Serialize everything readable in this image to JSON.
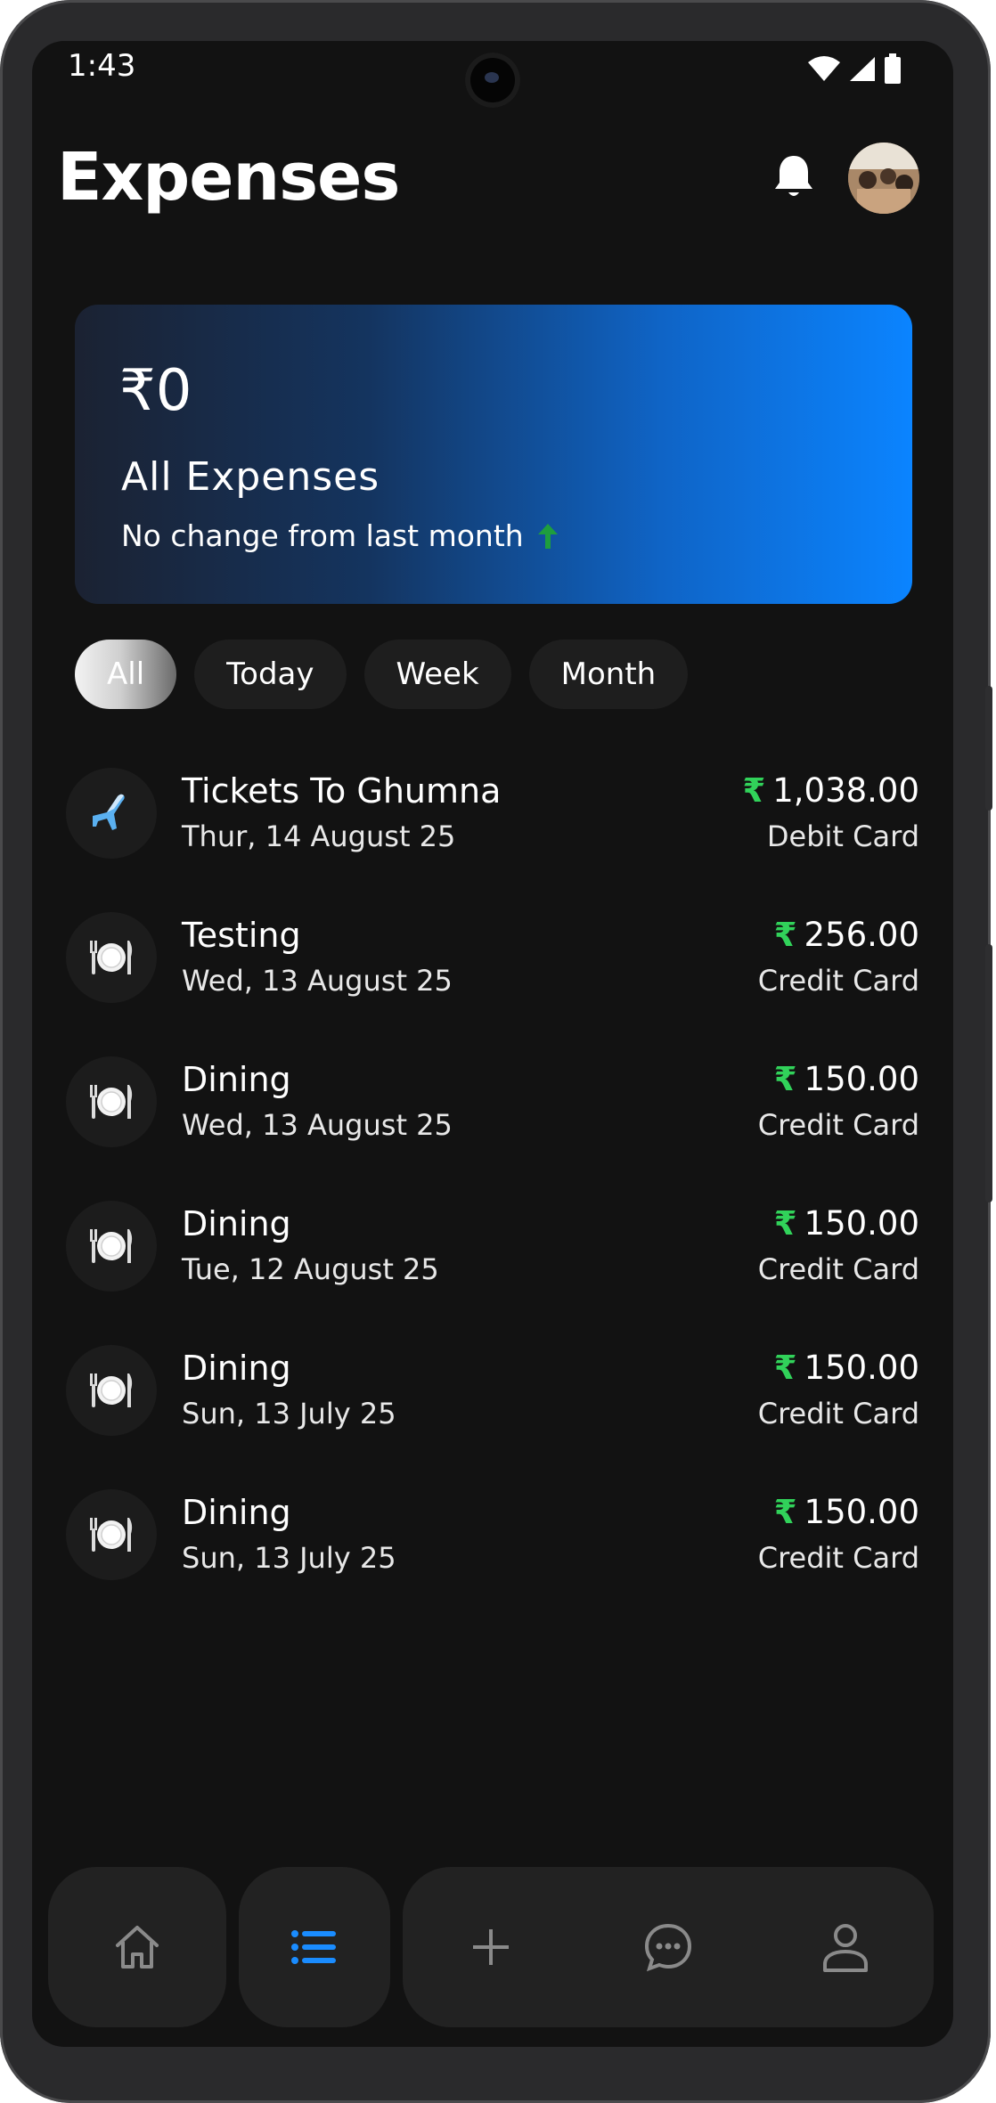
{
  "status_bar": {
    "time": "1:43",
    "icons": [
      "wifi-icon",
      "signal-icon",
      "battery-icon"
    ]
  },
  "header": {
    "title": "Expenses",
    "bell_icon": "bell-icon",
    "avatar": "avatar"
  },
  "summary": {
    "currency_symbol": "₹",
    "amount": "0",
    "label": "All Expenses",
    "change_text": "No change from last month",
    "change_icon": "arrow-up-icon",
    "accent_color": "#0b84ff",
    "change_color": "#1e9e3e"
  },
  "filters": [
    {
      "label": "All",
      "active": true
    },
    {
      "label": "Today",
      "active": false
    },
    {
      "label": "Week",
      "active": false
    },
    {
      "label": "Month",
      "active": false
    }
  ],
  "expenses": [
    {
      "icon": "airplane-icon",
      "title": "Tickets To Ghumna",
      "date": "Thur, 14 August 25",
      "currency": "₹",
      "amount": "1,038.00",
      "method": "Debit Card"
    },
    {
      "icon": "plate-icon",
      "title": "Testing",
      "date": "Wed, 13 August 25",
      "currency": "₹",
      "amount": "256.00",
      "method": "Credit Card"
    },
    {
      "icon": "plate-icon",
      "title": "Dining",
      "date": "Wed, 13 August 25",
      "currency": "₹",
      "amount": "150.00",
      "method": "Credit Card"
    },
    {
      "icon": "plate-icon",
      "title": "Dining",
      "date": "Tue, 12 August 25",
      "currency": "₹",
      "amount": "150.00",
      "method": "Credit Card"
    },
    {
      "icon": "plate-icon",
      "title": "Dining",
      "date": "Sun, 13 July 25",
      "currency": "₹",
      "amount": "150.00",
      "method": "Credit Card"
    },
    {
      "icon": "plate-icon",
      "title": "Dining",
      "date": "Sun, 13 July 25",
      "currency": "₹",
      "amount": "150.00",
      "method": "Credit Card"
    }
  ],
  "amount_color": "#31d25a",
  "bottom_nav": {
    "items": [
      {
        "icon": "home-icon",
        "active": false
      },
      {
        "icon": "list-icon",
        "active": true
      },
      {
        "icon": "plus-icon",
        "active": false
      },
      {
        "icon": "chat-icon",
        "active": false
      },
      {
        "icon": "profile-icon",
        "active": false
      }
    ],
    "active_color": "#1a8cff",
    "inactive_color": "#8a8a8a"
  }
}
